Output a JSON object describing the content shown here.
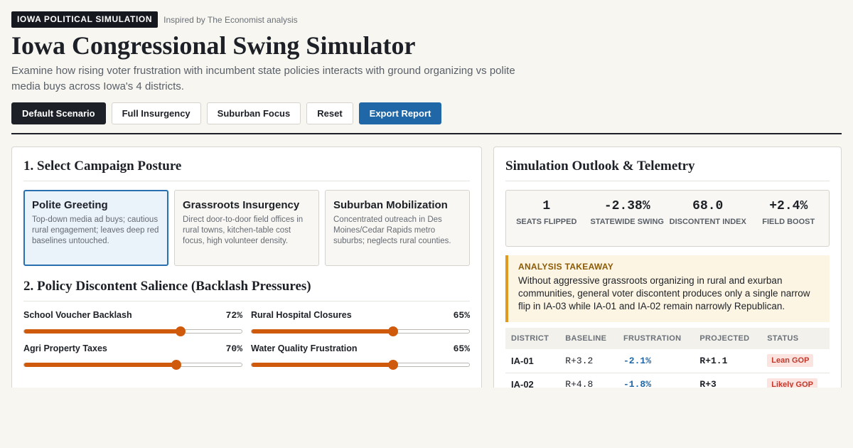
{
  "header": {
    "tag": "IOWA POLITICAL SIMULATION",
    "inspired": "Inspired by The Economist analysis",
    "title": "Iowa Congressional Swing Simulator",
    "subtitle": "Examine how rising voter frustration with incumbent state policies interacts with ground organizing vs polite media buys across Iowa's 4 districts."
  },
  "toolbar": {
    "default_label": "Default Scenario",
    "insurgency_label": "Full Insurgency",
    "suburban_label": "Suburban Focus",
    "reset_label": "Reset",
    "export_label": "Export Report"
  },
  "posture": {
    "title": "1. Select Campaign Posture",
    "cards": [
      {
        "title": "Polite Greeting",
        "desc": "Top-down media ad buys; cautious rural engagement; leaves deep red baselines untouched.",
        "active": true
      },
      {
        "title": "Grassroots Insurgency",
        "desc": "Direct door-to-door field offices in rural towns, kitchen-table cost focus, high volunteer density.",
        "active": false
      },
      {
        "title": "Suburban Mobilization",
        "desc": "Concentrated outreach in Des Moines/Cedar Rapids metro suburbs; neglects rural counties.",
        "active": false
      }
    ]
  },
  "discontent": {
    "title": "2. Policy Discontent Salience (Backlash Pressures)",
    "sliders": [
      {
        "label": "School Voucher Backlash",
        "value_text": "72%",
        "value": 72
      },
      {
        "label": "Rural Hospital Closures",
        "value_text": "65%",
        "value": 65
      },
      {
        "label": "Agri Property Taxes",
        "value_text": "70%",
        "value": 70
      },
      {
        "label": "Water Quality Frustration",
        "value_text": "65%",
        "value": 65
      }
    ]
  },
  "outlook": {
    "title": "Simulation Outlook & Telemetry",
    "stats": [
      {
        "value": "1",
        "label": "SEATS FLIPPED"
      },
      {
        "value": "-2.38%",
        "label": "STATEWIDE SWING"
      },
      {
        "value": "68.0",
        "label": "DISCONTENT INDEX"
      },
      {
        "value": "+2.4%",
        "label": "FIELD BOOST"
      }
    ],
    "takeaway": {
      "title": "ANALYSIS TAKEAWAY",
      "text": "Without aggressive grassroots organizing in rural and exurban communities, general voter discontent produces only a single narrow flip in IA-03 while IA-01 and IA-02 remain narrowly Republican."
    },
    "table": {
      "headers": [
        "DISTRICT",
        "BASELINE",
        "FRUSTRATION",
        "PROJECTED",
        "STATUS"
      ],
      "rows": [
        {
          "district": "IA-01",
          "baseline": "R+3.2",
          "frustration": "-2.1%",
          "projected": "R+1.1",
          "status": "Lean GOP"
        },
        {
          "district": "IA-02",
          "baseline": "R+4.8",
          "frustration": "-1.8%",
          "projected": "R+3",
          "status": "Likely GOP"
        }
      ]
    }
  },
  "colors": {
    "accent_blue": "#1f67a6",
    "slider_orange": "#d05a0c",
    "takeaway_amber": "#e19a1b",
    "gop_red": "#c0392b"
  }
}
